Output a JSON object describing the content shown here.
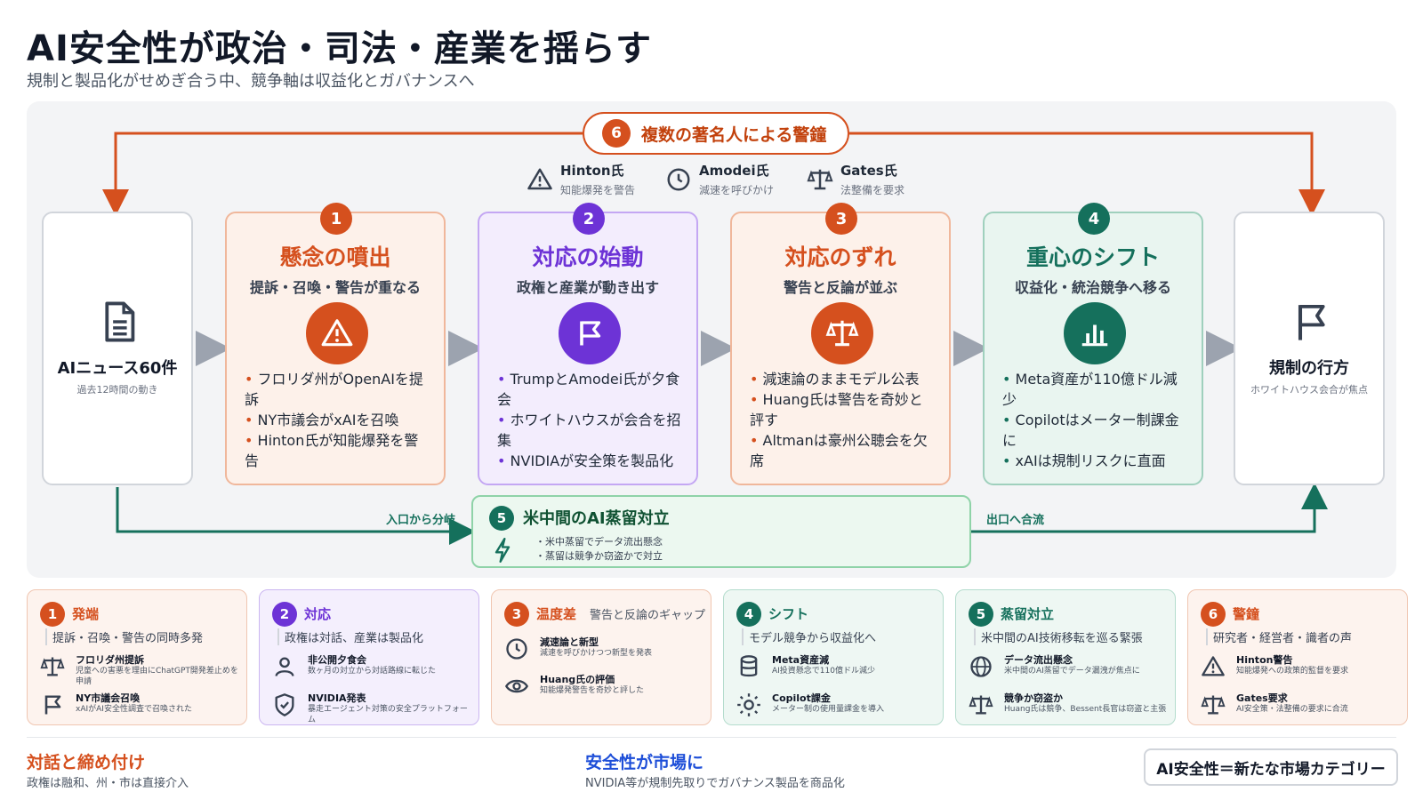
{
  "title": "AI安全性が政治・司法・産業を揺らす",
  "subtitle": "規制と製品化がせめぎ合う中、競争軸は収益化とガバナンスへ",
  "colors": {
    "orange": "#d5501e",
    "purple": "#6d33d6",
    "green": "#15705c"
  },
  "warning": {
    "num": "6",
    "label": "複数の著名人による警鐘"
  },
  "people": [
    {
      "name": "Hinton氏",
      "desc": "知能爆発を警告",
      "icon": "warning-icon"
    },
    {
      "name": "Amodei氏",
      "desc": "減速を呼びかけ",
      "icon": "clock-icon"
    },
    {
      "name": "Gates氏",
      "desc": "法整備を要求",
      "icon": "scales-icon"
    }
  ],
  "left_box": {
    "title": "AIニュース60件",
    "sub": "過去12時間の動き",
    "icon": "document-icon"
  },
  "right_box": {
    "title": "規制の行方",
    "sub": "ホワイトハウス会合が焦点",
    "icon": "flag-icon"
  },
  "stages": [
    {
      "num": "1",
      "title": "懸念の噴出",
      "sub": "提訴・召喚・警告が重なる",
      "icon": "warning-icon",
      "items": [
        "フロリダ州がOpenAIを提訴",
        "NY市議会がxAIを召喚",
        "Hinton氏が知能爆発を警告"
      ]
    },
    {
      "num": "2",
      "title": "対応の始動",
      "sub": "政権と産業が動き出す",
      "icon": "flag-icon",
      "items": [
        "TrumpとAmodei氏が夕食会",
        "ホワイトハウスが会合を招集",
        "NVIDIAが安全策を製品化"
      ]
    },
    {
      "num": "3",
      "title": "対応のずれ",
      "sub": "警告と反論が並ぶ",
      "icon": "scales-icon",
      "items": [
        "減速論のままモデル公表",
        "Huang氏は警告を奇妙と評す",
        "Altmanは豪州公聴会を欠席"
      ]
    },
    {
      "num": "4",
      "title": "重心のシフト",
      "sub": "収益化・統治競争へ移る",
      "icon": "bar-chart-icon",
      "items": [
        "Meta資産が110億ドル減少",
        "Copilotはメーター制課金に",
        "xAIは規制リスクに直面"
      ]
    }
  ],
  "distill": {
    "num": "5",
    "title": "米中間のAI蒸留対立",
    "lines": [
      "・米中蒸留でデータ流出懸念",
      "・蒸留は競争か窃盗かで対立"
    ]
  },
  "flow_labels": {
    "branch": "入口から分岐",
    "merge": "出口へ合流"
  },
  "cards": [
    {
      "num": "1",
      "title": "発端",
      "extra": "",
      "sub": "提訴・召喚・警告の同時多発",
      "items": [
        {
          "icon": "scales-icon",
          "title": "フロリダ州提訴",
          "desc": "児童への害悪を理由にChatGPT開発差止めを申請"
        },
        {
          "icon": "flag-icon",
          "title": "NY市議会召喚",
          "desc": "xAIがAI安全性調査で召喚された"
        }
      ]
    },
    {
      "num": "2",
      "title": "対応",
      "extra": "",
      "sub": "政権は対話、産業は製品化",
      "items": [
        {
          "icon": "person-icon",
          "title": "非公開夕食会",
          "desc": "数ヶ月の対立から対話路線に転じた"
        },
        {
          "icon": "shield-icon",
          "title": "NVIDIA発表",
          "desc": "暴走エージェント対策の安全プラットフォーム"
        }
      ]
    },
    {
      "num": "3",
      "title": "温度差",
      "extra": "警告と反論のギャップ",
      "sub": "",
      "items": [
        {
          "icon": "clock-icon",
          "title": "減速論と新型",
          "desc": "減速を呼びかけつつ新型を発表"
        },
        {
          "icon": "eye-icon",
          "title": "Huang氏の評価",
          "desc": "知能爆発警告を奇妙と評した"
        }
      ]
    },
    {
      "num": "4",
      "title": "シフト",
      "extra": "",
      "sub": "モデル競争から収益化へ",
      "items": [
        {
          "icon": "database-icon",
          "title": "Meta資産減",
          "desc": "AI投資懸念で110億ドル減少"
        },
        {
          "icon": "sun-icon",
          "title": "Copilot課金",
          "desc": "メーター制の使用量課金を導入"
        }
      ]
    },
    {
      "num": "5",
      "title": "蒸留対立",
      "extra": "",
      "sub": "米中間のAI技術移転を巡る緊張",
      "items": [
        {
          "icon": "globe-icon",
          "title": "データ流出懸念",
          "desc": "米中間のAI蒸留でデータ漏洩が焦点に"
        },
        {
          "icon": "scales-icon",
          "title": "競争か窃盗か",
          "desc": "Huang氏は競争、Bessent長官は窃盗と主張"
        }
      ]
    },
    {
      "num": "6",
      "title": "警鐘",
      "extra": "",
      "sub": "研究者・経営者・識者の声",
      "items": [
        {
          "icon": "warning-icon",
          "title": "Hinton警告",
          "desc": "知能爆発への政策的監督を要求"
        },
        {
          "icon": "scales-icon",
          "title": "Gates要求",
          "desc": "AI安全策・法整備の要求に合流"
        }
      ]
    }
  ],
  "footer": {
    "left_title": "対話と締め付け",
    "left_sub": "政権は融和、州・市は直接介入",
    "mid_title": "安全性が市場に",
    "mid_sub": "NVIDIA等が規制先取りでガバナンス製品を商品化",
    "box": "AI安全性＝新たな市場カテゴリー"
  }
}
